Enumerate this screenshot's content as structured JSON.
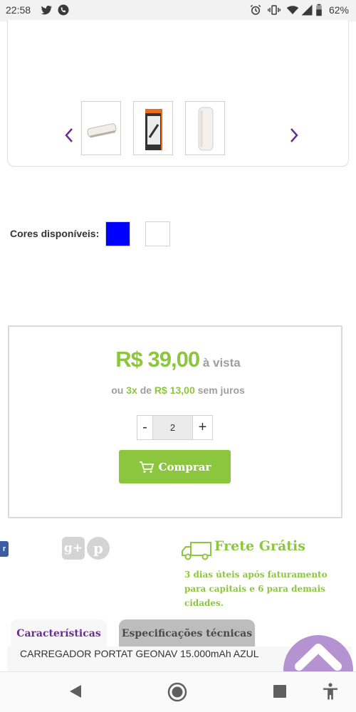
{
  "status_bar": {
    "time": "22:58",
    "battery_percent": "62%",
    "icons": [
      "twitter-icon",
      "whatsapp-icon",
      "alarm-icon",
      "vibrate-icon",
      "wifi-icon",
      "signal-icon",
      "battery-icon"
    ]
  },
  "gallery": {
    "thumbnails": [
      "powerbank-side-thumbnail",
      "powerbank-package-thumbnail",
      "powerbank-front-thumbnail"
    ],
    "prev_icon": "chevron-left-icon",
    "next_icon": "chevron-right-icon",
    "accent_color": "#6a2c91"
  },
  "colors": {
    "label": "Cores disponíveis:",
    "options": [
      "#0000ff",
      "#ffffff"
    ]
  },
  "price": {
    "amount": "R$ 39,00",
    "suffix": "à vista",
    "installment_prefix": "ou",
    "installment_count": "3x",
    "installment_de": "de",
    "installment_value": "R$ 13,00",
    "installment_suffix": "sem juros",
    "color": "#8cc63f"
  },
  "quantity": {
    "minus_label": "-",
    "value": "2",
    "plus_label": "+"
  },
  "buy_button": {
    "label": "Comprar",
    "icon": "cart-icon"
  },
  "social": {
    "facebook_fragment": "r",
    "google_plus_label": "g+",
    "pinterest_label": "p"
  },
  "shipping": {
    "title": "Frete Grátis",
    "description": "3 dias úteis após faturamento para capitais e 6 para demais cidades.",
    "icon": "truck-icon"
  },
  "tabs": [
    {
      "label": "Características"
    },
    {
      "label": "Especificações técnicas"
    }
  ],
  "product_name": "CARREGADOR PORTAT GEONAV 15.000mAh AZUL",
  "nav_bar": {
    "icons": [
      "back-icon",
      "home-icon",
      "recents-icon",
      "accessibility-icon"
    ]
  }
}
